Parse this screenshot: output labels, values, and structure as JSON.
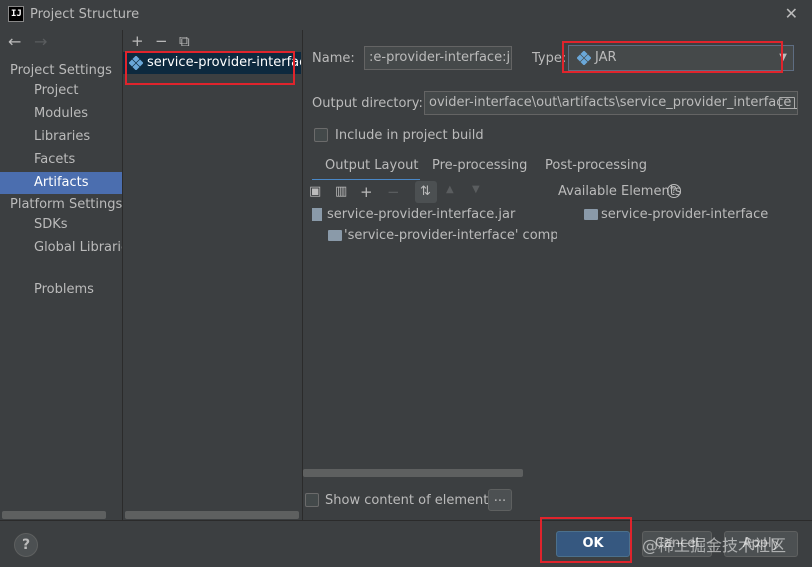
{
  "window": {
    "title": "Project Structure",
    "app_icon_text": "IJ",
    "close_glyph": "✕"
  },
  "nav": {
    "back_glyph": "←",
    "forward_glyph": "→"
  },
  "sidebar": {
    "project_settings_header": "Project Settings",
    "project_items": [
      {
        "label": "Project"
      },
      {
        "label": "Modules"
      },
      {
        "label": "Libraries"
      },
      {
        "label": "Facets"
      },
      {
        "label": "Artifacts",
        "selected": true
      }
    ],
    "platform_settings_header": "Platform Settings",
    "platform_items": [
      {
        "label": "SDKs"
      },
      {
        "label": "Global Libraries"
      }
    ],
    "problems": "Problems"
  },
  "artifacts_list": {
    "toolbar": {
      "add": "+",
      "remove": "−",
      "copy": "⧉"
    },
    "items": [
      {
        "label": "service-provider-interface:jar",
        "icon": "jar-artifact-icon"
      }
    ]
  },
  "form": {
    "name_label": "Name:",
    "name_value": ":e-provider-interface:jar",
    "type_label": "Type:",
    "type_value": "JAR",
    "output_dir_label": "Output directory:",
    "output_dir_value": "ovider-interface\\out\\artifacts\\service_provider_interface_jar",
    "include_in_build_label": "Include in project build",
    "include_in_build_checked": false
  },
  "tabs": [
    {
      "label": "Output Layout",
      "active": true
    },
    {
      "label": "Pre-processing"
    },
    {
      "label": "Post-processing"
    }
  ],
  "layout": {
    "available_elements_label": "Available Elements",
    "help_glyph": "?",
    "tree": [
      {
        "label": "service-provider-interface.jar",
        "icon": "jar-file-icon"
      },
      {
        "label": "'service-provider-interface' compile o",
        "icon": "folder-icon"
      }
    ],
    "available": [
      {
        "label": "service-provider-interface",
        "icon": "folder-icon"
      }
    ]
  },
  "show_content_label": "Show content of elements",
  "show_content_checked": false,
  "more_button": "...",
  "buttons": {
    "ok": "OK",
    "cancel": "Cancel",
    "apply": "Apply",
    "help": "?"
  },
  "watermark": "@稀土掘金技术社区",
  "colors": {
    "accent": "#4b6eaf",
    "primary_button": "#365880",
    "highlight_box": "#e0242c",
    "background": "#3c3f41"
  }
}
